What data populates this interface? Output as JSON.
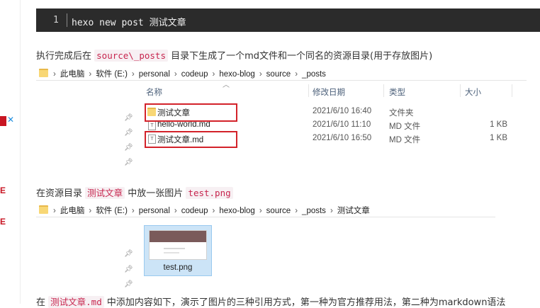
{
  "code_block": {
    "line_number": "1",
    "code": "hexo new post 测试文章"
  },
  "para1": {
    "before": "执行完成后在 ",
    "code": "source\\_posts",
    "after": " 目录下生成了一个md文件和一个同名的资源目录(用于存放图片)"
  },
  "explorer1": {
    "breadcrumb": [
      "此电脑",
      "软件 (E:)",
      "personal",
      "codeup",
      "hexo-blog",
      "source",
      "_posts"
    ],
    "columns": {
      "name": "名称",
      "date": "修改日期",
      "type": "类型",
      "size": "大小"
    },
    "files": [
      {
        "name": "测试文章",
        "date": "2021/6/10 16:40",
        "type": "文件夹",
        "size": "",
        "icon": "folder-icon"
      },
      {
        "name": "hello-world.md",
        "date": "2021/6/10 11:10",
        "type": "MD 文件",
        "size": "1 KB",
        "icon": "text-file-icon"
      },
      {
        "name": "测试文章.md",
        "date": "2021/6/10 16:50",
        "type": "MD 文件",
        "size": "1 KB",
        "icon": "text-file-icon"
      }
    ]
  },
  "para2": {
    "before": "在资源目录 ",
    "code1": "测试文章",
    "middle": " 中放一张图片 ",
    "code2": "test.png"
  },
  "explorer2": {
    "breadcrumb": [
      "此电脑",
      "软件 (E:)",
      "personal",
      "codeup",
      "hexo-blog",
      "source",
      "_posts",
      "测试文章"
    ],
    "file_name": "test.png"
  },
  "para3": {
    "before": "在 ",
    "code": "测试文章.md",
    "after": " 中添加内容如下，演示了图片的三种引用方式，第一种为官方推荐用法，第二种为markdown语法"
  },
  "sidebar": {
    "ad_label": "✕",
    "mark1": "E",
    "mark2": "E"
  },
  "colors": {
    "inline_code": "#c7254e",
    "highlight_box": "#d3222a",
    "code_bg": "#2b2b2b"
  }
}
